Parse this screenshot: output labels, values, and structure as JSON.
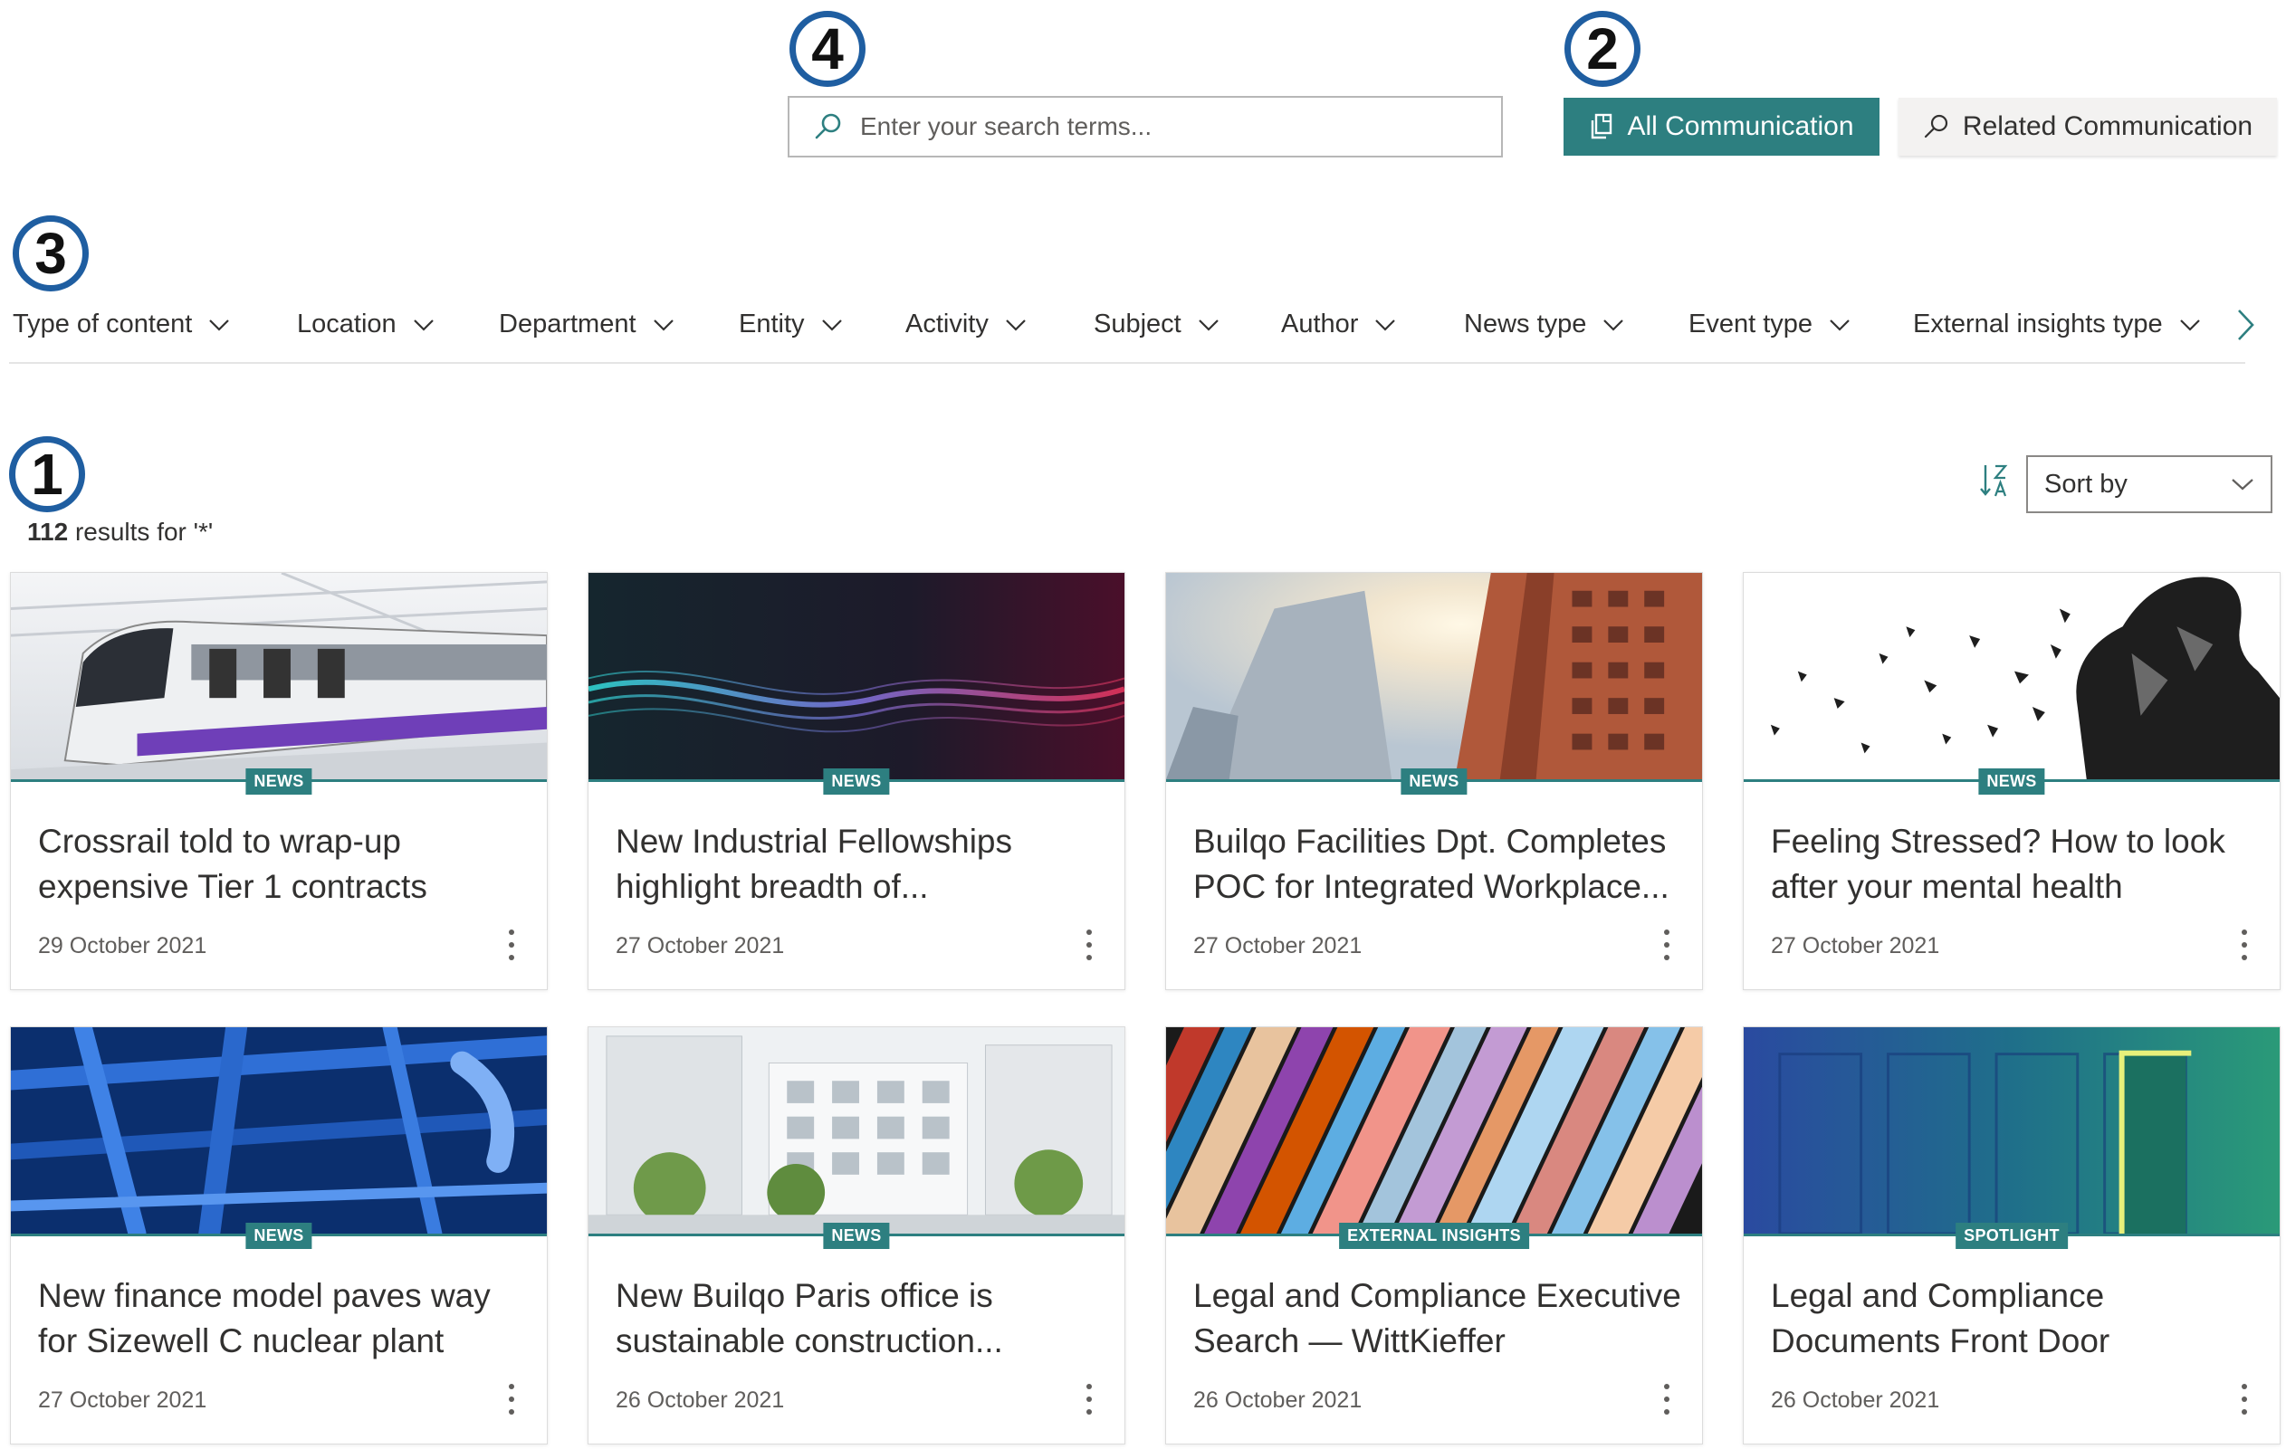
{
  "markers": {
    "m1": "1",
    "m2": "2",
    "m3": "3",
    "m4": "4"
  },
  "search": {
    "placeholder": "Enter your search terms..."
  },
  "toggles": {
    "all": "All Communication",
    "related": "Related Communication"
  },
  "filters": [
    "Type of content",
    "Location",
    "Department",
    "Entity",
    "Activity",
    "Subject",
    "Author",
    "News type",
    "Event type",
    "External insights type"
  ],
  "results": {
    "count": "112",
    "suffix": " results for '*'"
  },
  "sort": {
    "label": "Sort by"
  },
  "cards": [
    {
      "badge": "NEWS",
      "title": "Crossrail told to wrap-up expensive Tier 1 contracts",
      "date": "29 October 2021",
      "image": "train"
    },
    {
      "badge": "NEWS",
      "title": "New Industrial Fellowships highlight breadth of...",
      "date": "27 October 2021",
      "image": "waves"
    },
    {
      "badge": "NEWS",
      "title": "Builqo Facilities Dpt. Completes POC for Integrated Workplace...",
      "date": "27 October 2021",
      "image": "buildings"
    },
    {
      "badge": "NEWS",
      "title": "Feeling Stressed? How to look after your mental health",
      "date": "27 October 2021",
      "image": "shattered-figure"
    },
    {
      "badge": "NEWS",
      "title": "New finance model paves way for Sizewell C nuclear plant",
      "date": "27 October 2021",
      "image": "pipes"
    },
    {
      "badge": "NEWS",
      "title": "New Builqo Paris office is sustainable construction...",
      "date": "26 October 2021",
      "image": "paris-office"
    },
    {
      "badge": "EXTERNAL INSIGHTS",
      "title": "Legal and Compliance Executive Search — WittKieffer",
      "date": "26 October 2021",
      "image": "books"
    },
    {
      "badge": "SPOTLIGHT",
      "title": "Legal and Compliance Documents Front Door",
      "date": "26 October 2021",
      "image": "doors"
    }
  ]
}
